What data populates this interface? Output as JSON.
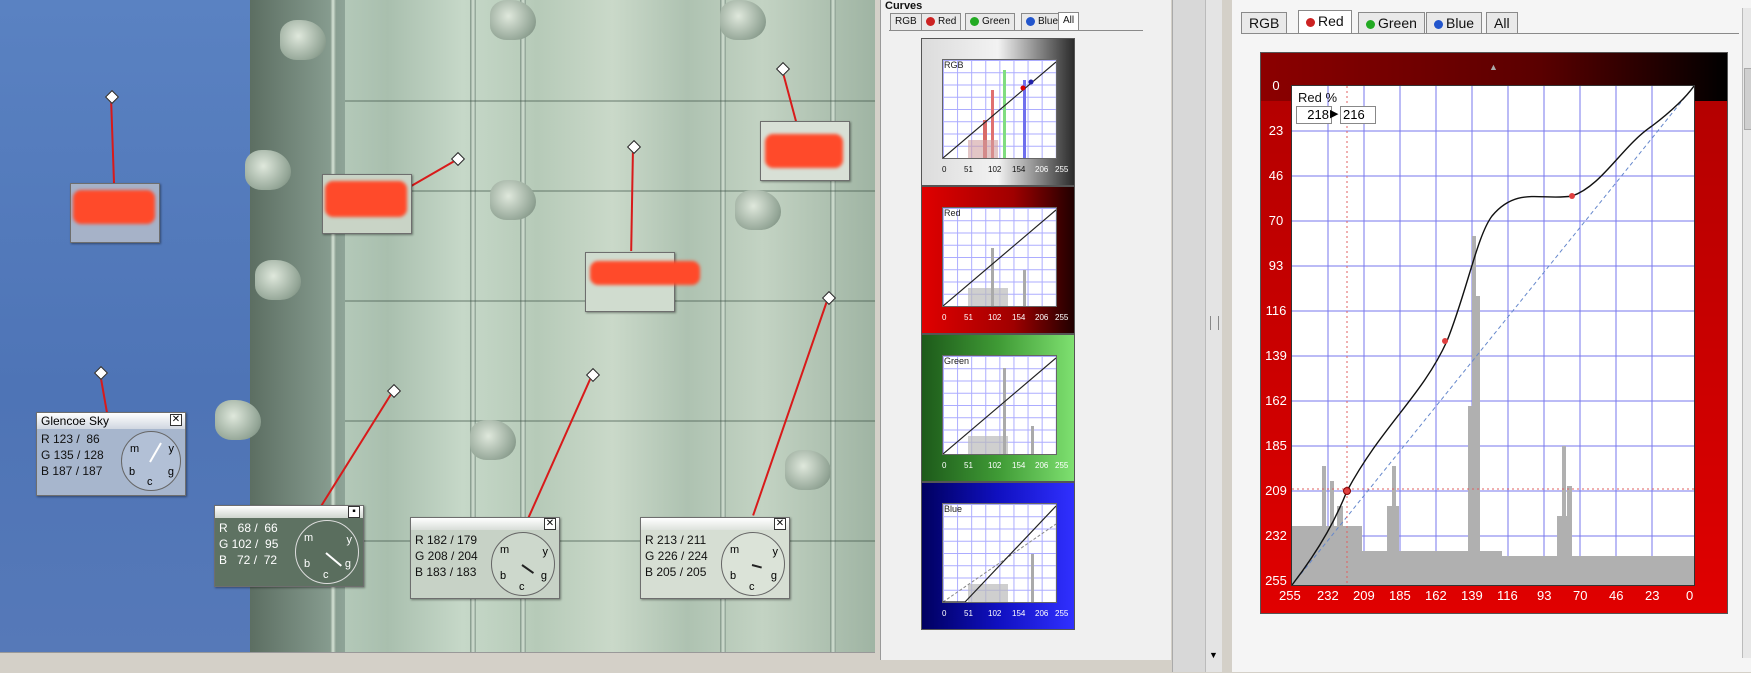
{
  "curves_panel": {
    "title": "Curves",
    "tabs": [
      {
        "label": "RGB",
        "dot": ""
      },
      {
        "label": "Red",
        "dot": "#cc2222"
      },
      {
        "label": "Green",
        "dot": "#22aa22"
      },
      {
        "label": "Blue",
        "dot": "#2255cc"
      },
      {
        "label": "All",
        "dot": ""
      }
    ],
    "active_tab": "All",
    "mini_charts": [
      {
        "label": "RGB",
        "bg": "#e8e8e8"
      },
      {
        "label": "Red",
        "bg": "#cc0000"
      },
      {
        "label": "Green",
        "bg": "#44aa33"
      },
      {
        "label": "Blue",
        "bg": "#1a1ab8"
      }
    ],
    "axis_ticks": [
      "0",
      "51",
      "102",
      "154",
      "206",
      "255"
    ]
  },
  "probes": [
    {
      "title": "Glencoe Sky",
      "rows": [
        "R 123 /  86",
        "G 135 / 128",
        "B 187 / 187"
      ]
    },
    {
      "title": "",
      "rows": [
        "R   68 /  66",
        "G 102 /  95",
        "B   72 /  72"
      ]
    },
    {
      "title": "",
      "rows": [
        "R 182 / 179",
        "G 208 / 204",
        "B 183 / 183"
      ]
    },
    {
      "title": "",
      "rows": [
        "R 213 / 211",
        "G 226 / 224",
        "B 205 / 205"
      ]
    }
  ],
  "dial_letters": {
    "m": "m",
    "y": "y",
    "b": "b",
    "c": "c",
    "g": "g"
  },
  "right_panel": {
    "tabs": [
      {
        "label": "RGB",
        "dot": ""
      },
      {
        "label": "Red",
        "dot": "#cc2222"
      },
      {
        "label": "Green",
        "dot": "#22aa22"
      },
      {
        "label": "Blue",
        "dot": "#2255cc"
      },
      {
        "label": "All",
        "dot": ""
      }
    ],
    "active_tab": "Red",
    "readout_label": "Red %",
    "readout_in": "218",
    "readout_arrow": "▶",
    "readout_out": "216",
    "y_ticks": [
      "0",
      "23",
      "46",
      "70",
      "93",
      "116",
      "139",
      "162",
      "185",
      "209",
      "232",
      "255"
    ],
    "x_ticks": [
      "255",
      "232",
      "209",
      "185",
      "162",
      "139",
      "116",
      "93",
      "70",
      "46",
      "23",
      "0"
    ]
  },
  "colors": {
    "red_line": "#d81a1a",
    "grid": "#7777ee",
    "hist": "#b0b0b0"
  }
}
